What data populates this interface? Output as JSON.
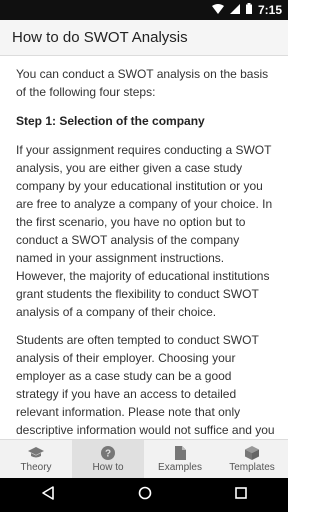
{
  "status_bar": {
    "time": "7:15"
  },
  "header": {
    "title": "How to do SWOT Analysis"
  },
  "content": {
    "intro": "You can conduct a SWOT analysis on the basis of the following four steps:",
    "step1_heading": "Step 1: Selection of the company",
    "para1": "If your assignment requires conducting a SWOT analysis, you are either given a case study company by your educational institution or you are free to analyze a company of your choice. In the first scenario, you have no option but to conduct a SWOT analysis of the company named in your assignment instructions. However, the majority of educational institutions grant students the flexibility to conduct SWOT analysis of a company of their choice.",
    "para2": "Students are often tempted to conduct SWOT analysis of their employer. Choosing your employer as a case study can be a good strategy if you have an access to detailed relevant information. Please note that only descriptive information would not suffice and you will have to justify your arguments by"
  },
  "bottom_nav": {
    "items": [
      {
        "label": "Theory",
        "icon": "graduation-cap-icon"
      },
      {
        "label": "How to",
        "icon": "question-circle-icon",
        "active": true
      },
      {
        "label": "Examples",
        "icon": "document-icon"
      },
      {
        "label": "Templates",
        "icon": "box-icon"
      }
    ]
  },
  "colors": {
    "status_bar": "#101010",
    "app_bar": "#f5f5f5",
    "nav_active": "#e0e0e0",
    "system_nav": "#000000"
  }
}
